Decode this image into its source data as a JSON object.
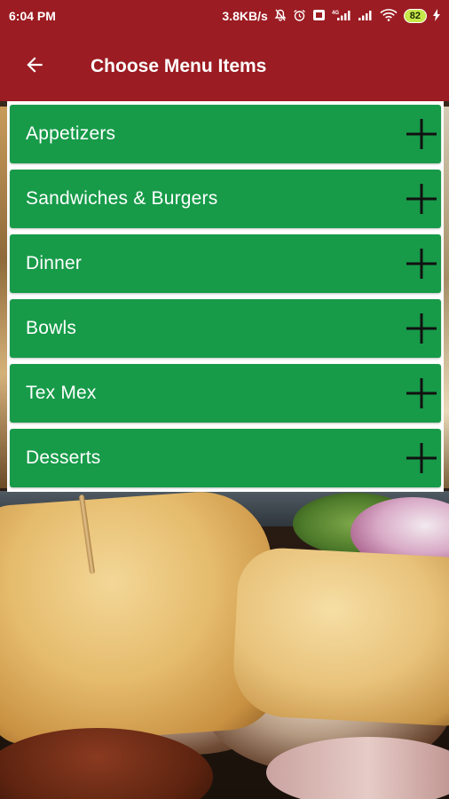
{
  "status_bar": {
    "time": "6:04 PM",
    "network_speed": "3.8KB/s",
    "battery_level": "82"
  },
  "app_bar": {
    "title": "Choose Menu Items",
    "back_icon": "arrow-back-icon"
  },
  "menu": {
    "items": [
      {
        "label": "Appetizers",
        "icon": "plus-icon"
      },
      {
        "label": "Sandwiches & Burgers",
        "icon": "plus-icon"
      },
      {
        "label": "Dinner",
        "icon": "plus-icon"
      },
      {
        "label": "Bowls",
        "icon": "plus-icon"
      },
      {
        "label": "Tex Mex",
        "icon": "plus-icon"
      },
      {
        "label": "Desserts",
        "icon": "plus-icon"
      }
    ]
  },
  "colors": {
    "app_bar": "#9b1c22",
    "menu_item": "#179b49",
    "menu_item_text": "#ffffff"
  }
}
